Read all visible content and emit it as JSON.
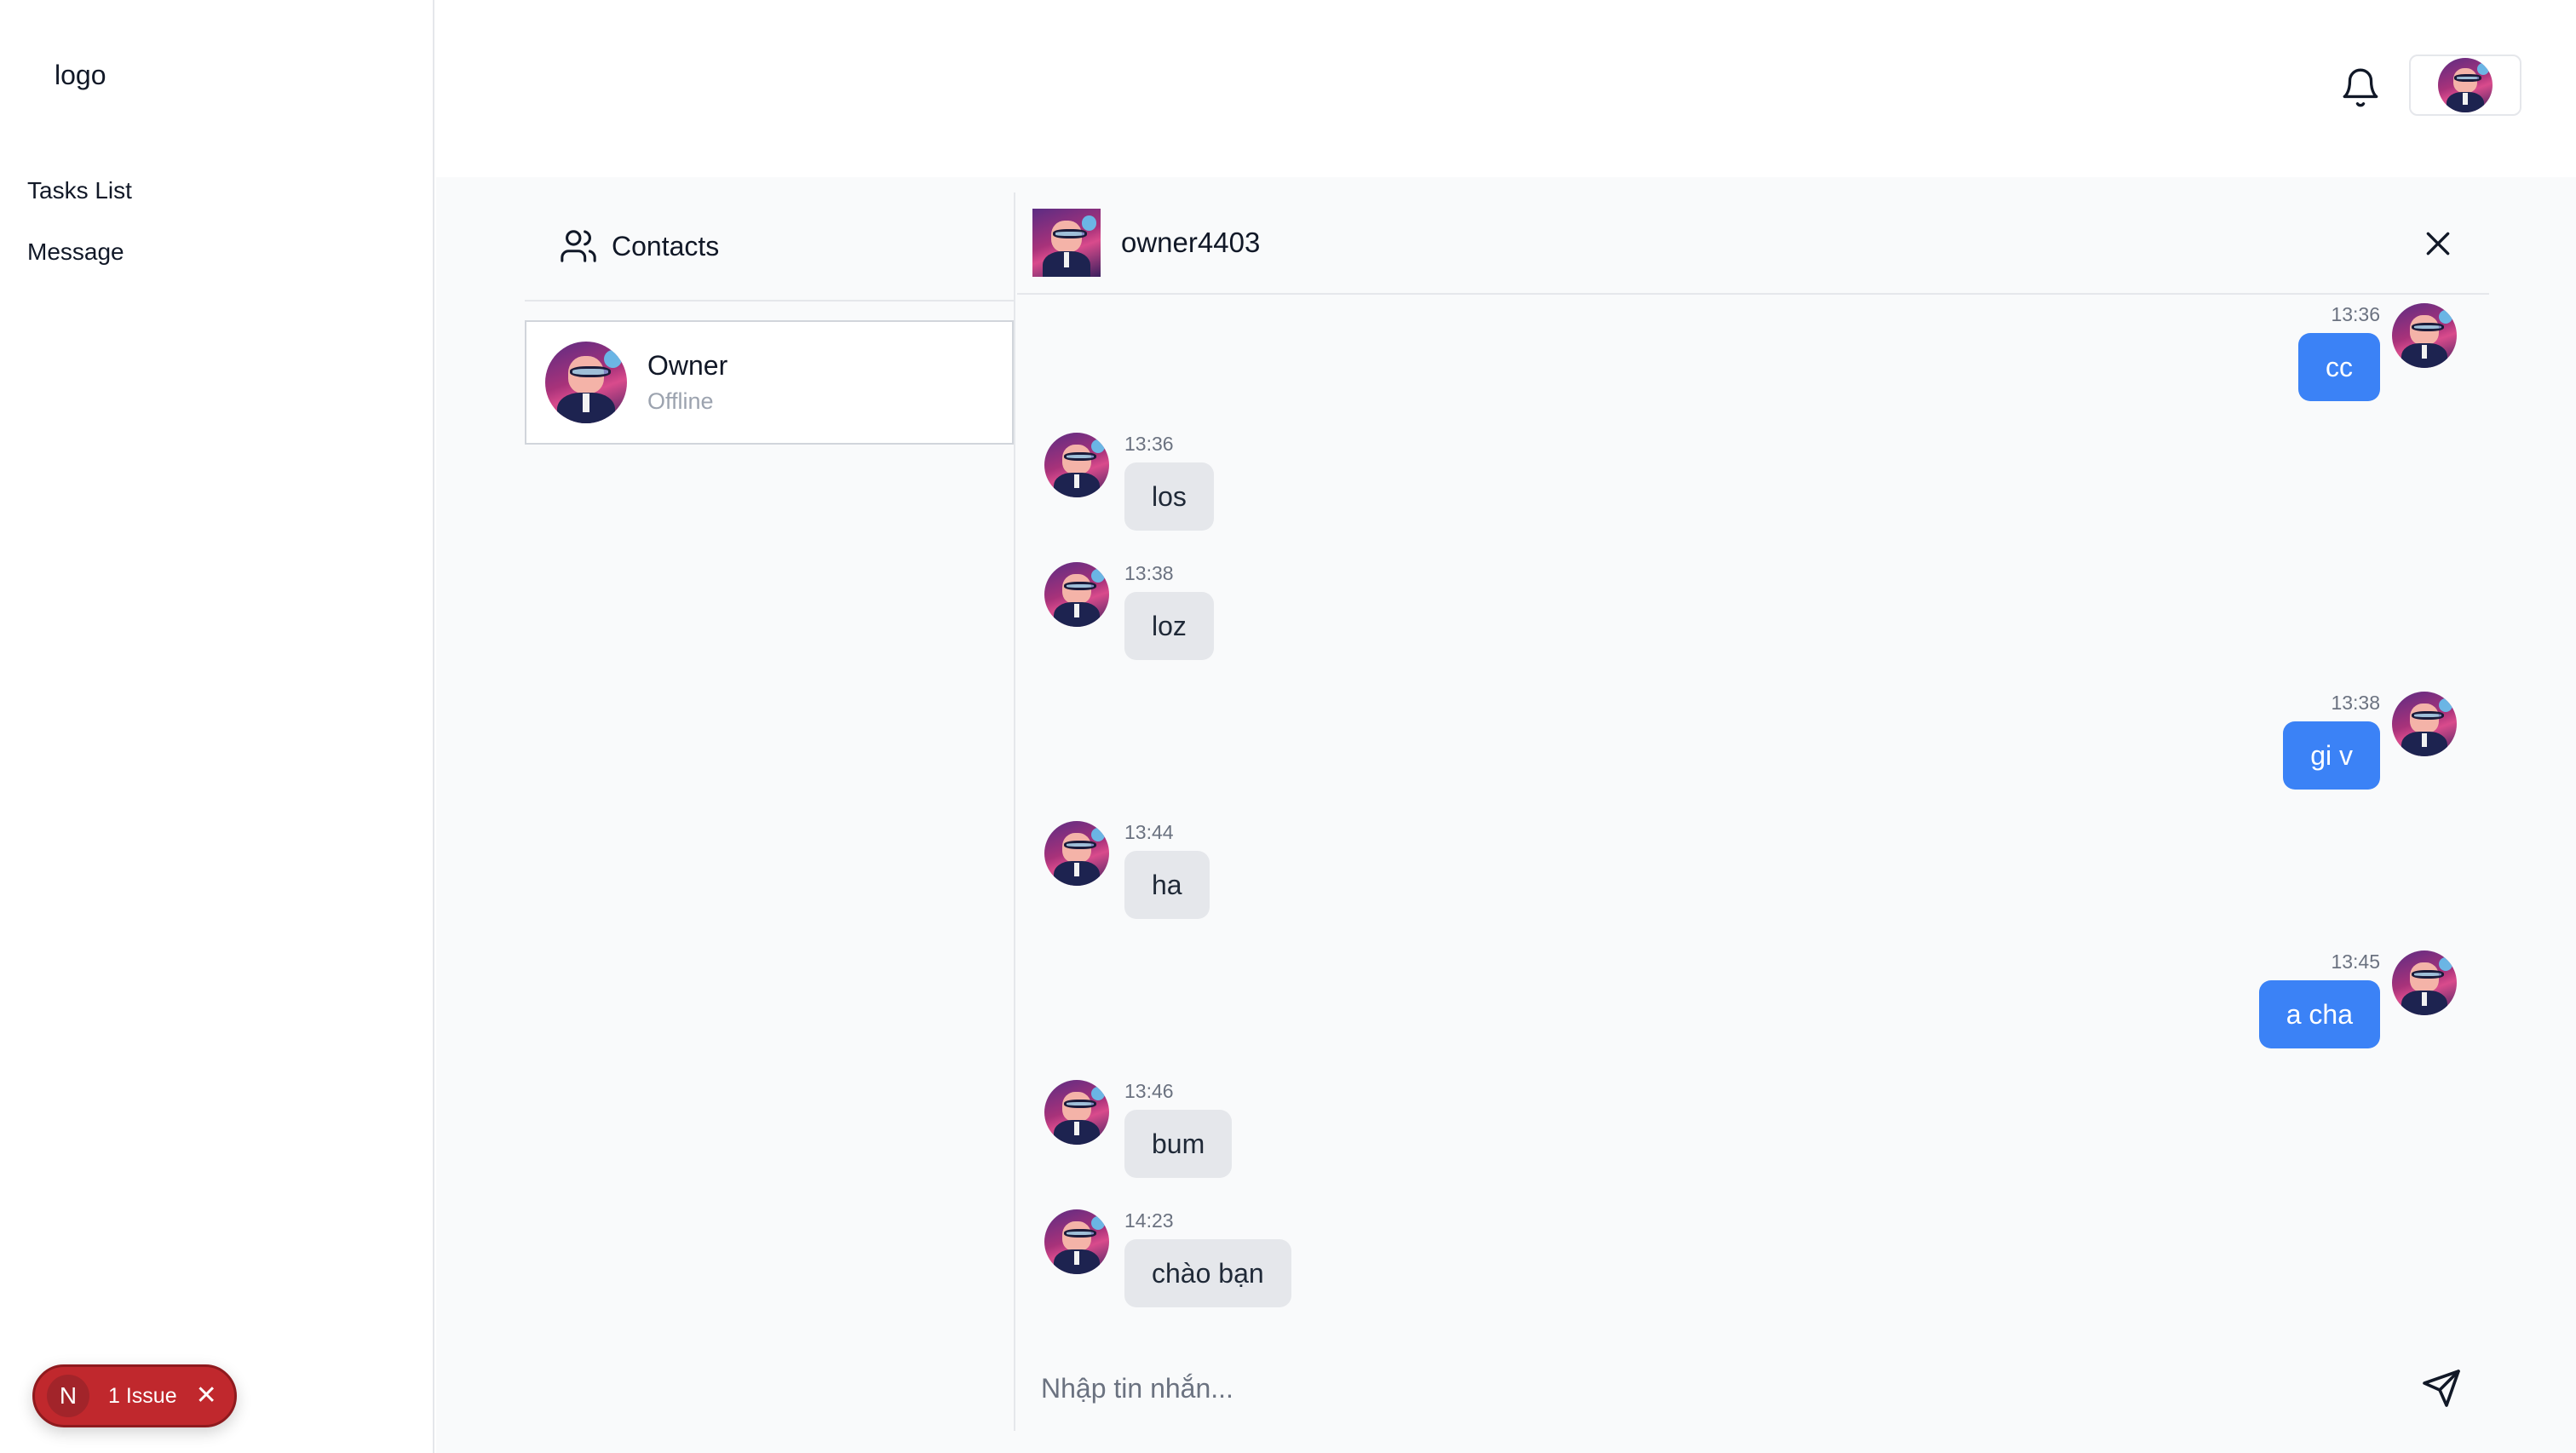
{
  "sidebar": {
    "logo": "logo",
    "items": [
      {
        "label": "Tasks List"
      },
      {
        "label": "Message"
      }
    ]
  },
  "header": {
    "notification_icon": "bell-icon",
    "user_avatar": "avatar"
  },
  "issue_badge": {
    "initial": "N",
    "label": "1 Issue"
  },
  "contacts": {
    "title": "Contacts",
    "list": [
      {
        "name": "Owner",
        "status": "Offline"
      }
    ]
  },
  "chat": {
    "username": "owner4403",
    "messages": [
      {
        "direction": "out",
        "time": "13:36",
        "text": "cc"
      },
      {
        "direction": "in",
        "time": "13:36",
        "text": "los"
      },
      {
        "direction": "in",
        "time": "13:38",
        "text": "loz"
      },
      {
        "direction": "out",
        "time": "13:38",
        "text": "gi v"
      },
      {
        "direction": "in",
        "time": "13:44",
        "text": "ha"
      },
      {
        "direction": "out",
        "time": "13:45",
        "text": "a cha"
      },
      {
        "direction": "in",
        "time": "13:46",
        "text": "bum"
      },
      {
        "direction": "in",
        "time": "14:23",
        "text": "chào bạn"
      }
    ],
    "composer_placeholder": "Nhập tin nhắn..."
  },
  "colors": {
    "outgoing_bubble": "#3b82f6",
    "incoming_bubble": "#e5e7eb",
    "issue_badge": "#c0282d"
  }
}
